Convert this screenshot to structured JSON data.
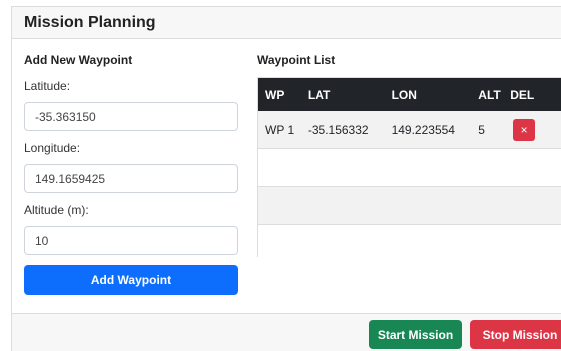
{
  "header": {
    "title": "Mission Planning"
  },
  "form": {
    "section_title": "Add New Waypoint",
    "latitude_label": "Latitude:",
    "latitude_value": "-35.363150",
    "longitude_label": "Longitude:",
    "longitude_value": "149.1659425",
    "altitude_label": "Altitude (m):",
    "altitude_value": "10",
    "add_button": "Add Waypoint"
  },
  "list": {
    "section_title": "Waypoint List",
    "columns": [
      "WP",
      "LAT",
      "LON",
      "ALT",
      "DEL"
    ],
    "rows": [
      {
        "wp": "WP 1",
        "lat": "-35.156332",
        "lon": "149.223554",
        "alt": "5",
        "del": "×"
      }
    ]
  },
  "footer": {
    "start_button": "Start Mission",
    "stop_button": "Stop Mission"
  },
  "colors": {
    "primary": "#0d6efd",
    "success": "#198754",
    "danger": "#dc3545",
    "table_header": "#212529"
  }
}
